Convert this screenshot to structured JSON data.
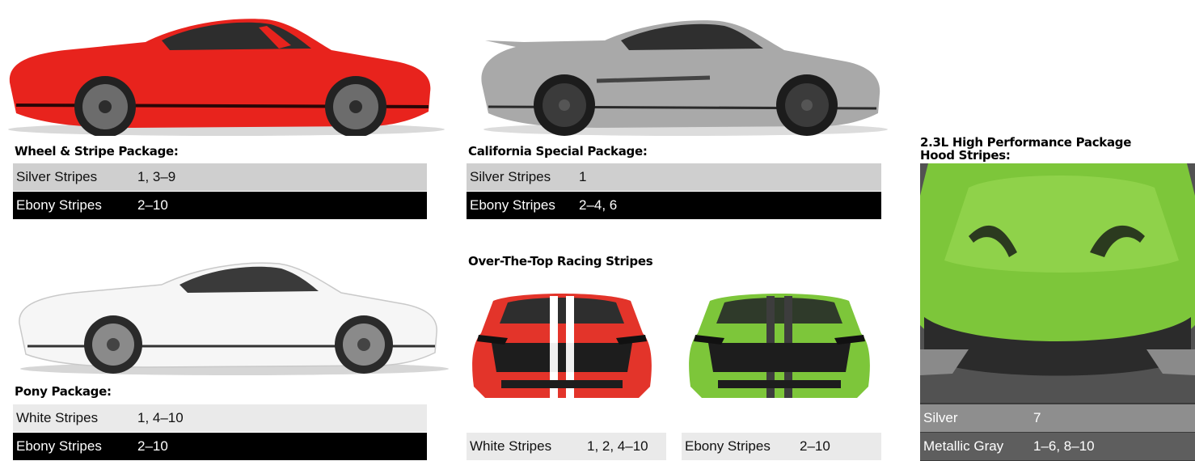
{
  "wheel_stripe": {
    "heading": "Wheel & Stripe Package:",
    "rows": [
      {
        "label": "Silver Stripes",
        "value": "1, 3–9"
      },
      {
        "label": "Ebony Stripes",
        "value": "2–10"
      }
    ]
  },
  "pony": {
    "heading": "Pony Package:",
    "rows": [
      {
        "label": "White Stripes",
        "value": "1, 4–10"
      },
      {
        "label": "Ebony Stripes",
        "value": "2–10"
      }
    ]
  },
  "california": {
    "heading": "California Special Package:",
    "rows": [
      {
        "label": "Silver Stripes",
        "value": "1"
      },
      {
        "label": "Ebony Stripes",
        "value": "2–4, 6"
      }
    ]
  },
  "over_the_top": {
    "heading": "Over-The-Top Racing Stripes",
    "white": {
      "label": "White Stripes",
      "value": "1, 2, 4–10"
    },
    "ebony": {
      "label": "Ebony Stripes",
      "value": "2–10"
    }
  },
  "hood": {
    "heading_line1": "2.3L High Performance Package",
    "heading_line2": "Hood Stripes:",
    "rows": [
      {
        "label": "Silver",
        "value": "7"
      },
      {
        "label": "Metallic Gray",
        "value": "1–6, 8–10"
      }
    ]
  },
  "colors": {
    "red_car": "#e8231d",
    "silver_car": "#a9a9a9",
    "white_car": "#f6f6f6",
    "green_car": "#7dc63a",
    "table_gray": "#cfcfcf",
    "table_black": "#000000"
  }
}
